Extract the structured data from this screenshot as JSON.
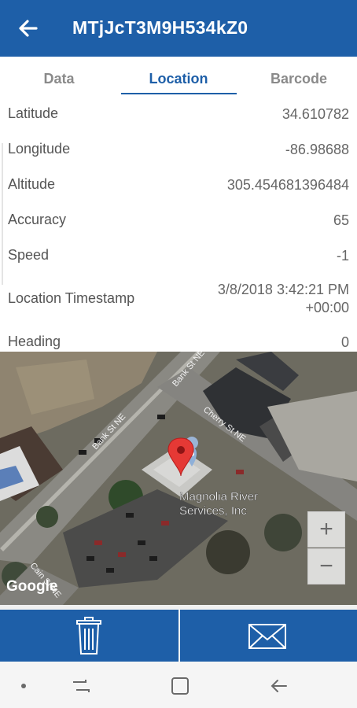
{
  "app_bar": {
    "title": "MTjJcT3M9H534kZ0",
    "back_icon": "arrow-left-icon",
    "background": "#1e5fa8"
  },
  "tabs": [
    {
      "label": "Data",
      "active": false
    },
    {
      "label": "Location",
      "active": true
    },
    {
      "label": "Barcode",
      "active": false
    }
  ],
  "details": [
    {
      "label": "Latitude",
      "value": "34.610782"
    },
    {
      "label": "Longitude",
      "value": "-86.98688"
    },
    {
      "label": "Altitude",
      "value": "305.454681396484"
    },
    {
      "label": "Accuracy",
      "value": "65"
    },
    {
      "label": "Speed",
      "value": "-1"
    },
    {
      "label": "Location Timestamp",
      "value_line1": "3/8/2018 3:42:21 PM",
      "value_line2": "+00:00"
    },
    {
      "label": "Heading",
      "value": "0"
    }
  ],
  "map": {
    "streets": [
      "Bank St NE",
      "Bank St NE",
      "Cherry St NE",
      "Cain St NE"
    ],
    "place_label": [
      "Magnolia River",
      "Services, Inc"
    ],
    "attribution": "Google",
    "zoom_in": "+",
    "zoom_out": "−",
    "pin_color": "#e53935"
  },
  "actions": [
    {
      "icon": "trash-icon"
    },
    {
      "icon": "envelope-icon"
    }
  ],
  "system_nav": [
    "dot-icon",
    "recents-icon",
    "home-icon",
    "back-icon"
  ]
}
